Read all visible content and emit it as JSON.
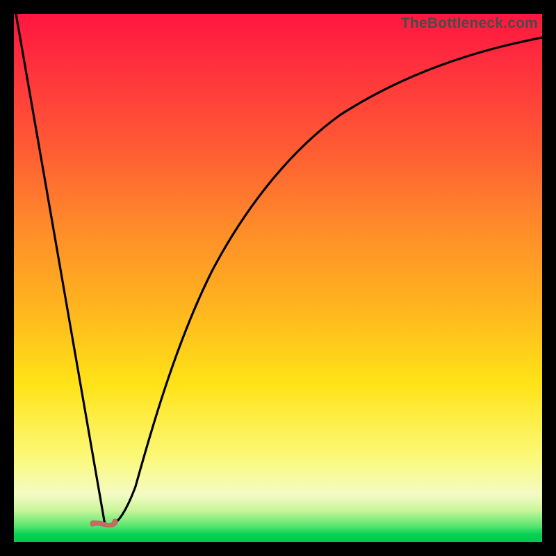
{
  "watermark": "TheBottleneck.com",
  "colors": {
    "frame": "#000000",
    "curve": "#000000",
    "marker": "#c66b63",
    "gradient_top": "#ff163f",
    "gradient_bottom": "#00c84f"
  },
  "chart_data": {
    "type": "line",
    "title": "",
    "xlabel": "",
    "ylabel": "",
    "xlim": [
      0,
      1
    ],
    "ylim": [
      0,
      1
    ],
    "grid": false,
    "legend": false,
    "annotations": [
      {
        "text": "TheBottleneck.com",
        "position": "top-right"
      }
    ],
    "series": [
      {
        "name": "bottleneck-curve",
        "x": [
          0.0,
          0.05,
          0.1,
          0.14,
          0.17,
          0.2,
          0.25,
          0.3,
          0.35,
          0.4,
          0.45,
          0.5,
          0.55,
          0.6,
          0.65,
          0.7,
          0.75,
          0.8,
          0.85,
          0.9,
          0.95,
          1.0
        ],
        "y": [
          1.0,
          0.71,
          0.42,
          0.18,
          0.03,
          0.05,
          0.22,
          0.37,
          0.5,
          0.6,
          0.68,
          0.74,
          0.79,
          0.83,
          0.86,
          0.88,
          0.9,
          0.92,
          0.93,
          0.94,
          0.95,
          0.96
        ],
        "note": "y is normalized 0=bottom(green) 1=top(red); curve dips to ~0.03 at x≈0.17 then rises asymptotically"
      }
    ],
    "minimum_marker": {
      "x": 0.17,
      "y": 0.035,
      "glyph": "worm"
    }
  }
}
